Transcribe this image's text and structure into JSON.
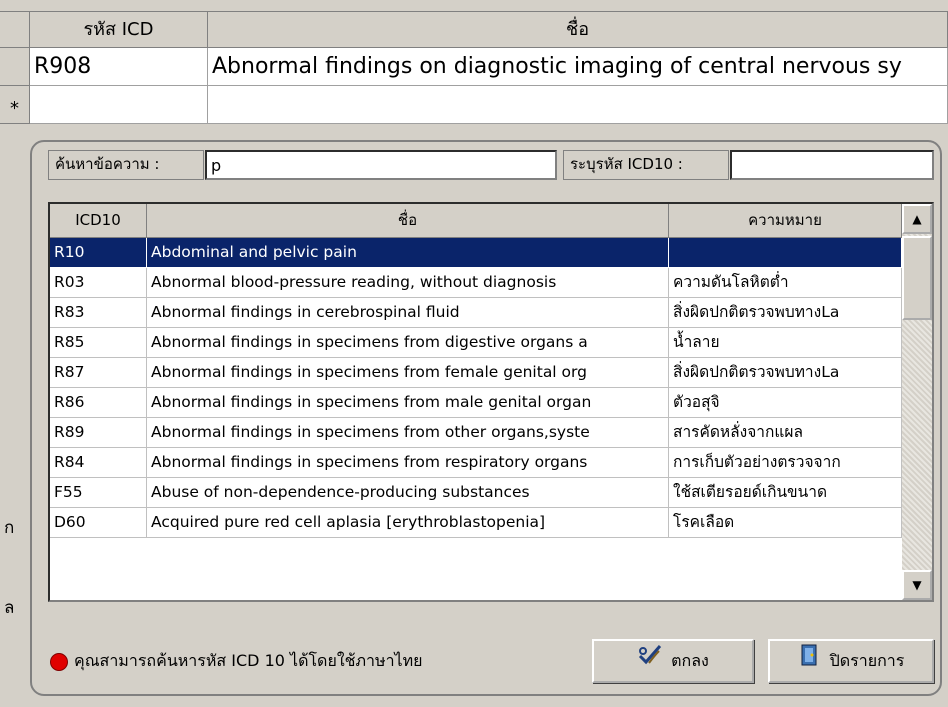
{
  "background_grid": {
    "headers": [
      "รหัส ICD",
      "ชื่อ"
    ],
    "new_row_marker": "*",
    "rows": [
      {
        "code": "R908",
        "name": "Abnormal findings on diagnostic imaging of central nervous sy"
      }
    ]
  },
  "side_labels": [
    "ก",
    "ล"
  ],
  "search": {
    "label": "ค้นหาข้อความ :",
    "value": "p",
    "code_label": "ระบุรหัส ICD10 :",
    "code_value": ""
  },
  "list": {
    "columns": [
      "ICD10",
      "ชื่อ",
      "ความหมาย"
    ],
    "rows": [
      {
        "code": "R10",
        "name": "Abdominal and pelvic pain",
        "meaning": "",
        "selected": true
      },
      {
        "code": "R03",
        "name": "Abnormal blood-pressure reading, without diagnosis",
        "meaning": "ความดันโลหิตต่ำ"
      },
      {
        "code": "R83",
        "name": "Abnormal findings in cerebrospinal fluid",
        "meaning": "สิ่งผิดปกติตรวจพบทางLa"
      },
      {
        "code": "R85",
        "name": "Abnormal findings in specimens from digestive organs a",
        "meaning": "น้ำลาย"
      },
      {
        "code": "R87",
        "name": "Abnormal findings in specimens from female genital org",
        "meaning": "สิ่งผิดปกติตรวจพบทางLa"
      },
      {
        "code": "R86",
        "name": "Abnormal findings in specimens from male genital organ",
        "meaning": "ตัวอสุจิ"
      },
      {
        "code": "R89",
        "name": "Abnormal findings in specimens from other organs,syste",
        "meaning": "สารคัดหลั่งจากแผล"
      },
      {
        "code": "R84",
        "name": "Abnormal findings in specimens from respiratory organs",
        "meaning": "การเก็บตัวอย่างตรวจจาก"
      },
      {
        "code": "F55",
        "name": "Abuse of non-dependence-producing substances",
        "meaning": "ใช้สเตียรอยด์เกินขนาด"
      },
      {
        "code": "D60",
        "name": "Acquired  pure red cell aplasia [erythroblastopenia]",
        "meaning": "โรคเลือด"
      }
    ]
  },
  "hint": "คุณสามารถค้นหารหัส ICD 10 ได้โดยใช้ภาษาไทย",
  "buttons": {
    "ok": "ตกลง",
    "close": "ปิดรายการ"
  },
  "colors": {
    "selection": "#0a246a",
    "hint_dot": "#e00000",
    "window_bg": "#d4d0c8"
  }
}
